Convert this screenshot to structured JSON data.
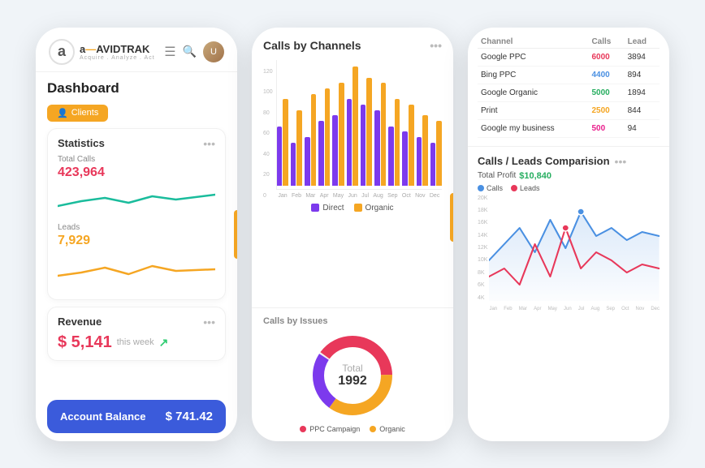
{
  "app": {
    "name": "AVIDTRAK",
    "tagline": "Acquire . Analyze . Act"
  },
  "left_phone": {
    "dashboard_title": "Dashboard",
    "clients_btn": "Clients",
    "statistics": {
      "title": "Statistics",
      "total_calls_label": "Total Calls",
      "total_calls_value": "423,964",
      "leads_label": "Leads",
      "leads_value": "7,929"
    },
    "revenue": {
      "title": "Revenue",
      "amount": "$ 5,141",
      "period": "this week"
    },
    "account_balance": {
      "label": "Account Balance",
      "amount": "$ 741.42"
    }
  },
  "middle_phone": {
    "chart_title": "Calls by Channels",
    "bar_data": {
      "months": [
        "Jan",
        "Feb",
        "Mar",
        "Apr",
        "May",
        "Jun",
        "Jul",
        "Aug",
        "Sep",
        "Oct",
        "Nov",
        "Dec"
      ],
      "direct": [
        55,
        40,
        45,
        60,
        65,
        80,
        75,
        70,
        55,
        50,
        45,
        40
      ],
      "organic": [
        80,
        70,
        85,
        90,
        95,
        110,
        100,
        95,
        80,
        75,
        65,
        60
      ]
    },
    "legend": {
      "direct": "Direct",
      "organic": "Organic"
    },
    "y_axis": [
      "120",
      "100",
      "80",
      "60",
      "40",
      "20",
      "0"
    ],
    "donut_section_title": "Calls by Issues",
    "donut": {
      "total_label": "Total",
      "total_value": "1992",
      "ppc_label": "PPC Campaign",
      "organic_label": "Organic",
      "ppc_color": "#e8385a",
      "organic_color": "#f5a623",
      "ring_color": "#7c3aed"
    }
  },
  "right_phone": {
    "table": {
      "headers": [
        "Channel",
        "Calls",
        "Lead"
      ],
      "rows": [
        {
          "channel": "Google PPC",
          "calls": "6000",
          "lead": "3894",
          "calls_class": "red"
        },
        {
          "channel": "Bing PPC",
          "calls": "4400",
          "lead": "894",
          "calls_class": "blue"
        },
        {
          "channel": "Google Organic",
          "calls": "5000",
          "lead": "1894",
          "calls_class": "green"
        },
        {
          "channel": "Print",
          "calls": "2500",
          "lead": "844",
          "calls_class": "orange"
        },
        {
          "channel": "Google my business",
          "calls": "500",
          "lead": "94",
          "calls_class": "pink"
        }
      ]
    },
    "line_chart": {
      "title": "Calls / Leads Comparision",
      "profit_label": "Total Profit",
      "profit_value": "$10,840",
      "calls_label": "Calls",
      "leads_label": "Leads",
      "calls_color": "#4a90e2",
      "leads_color": "#e8385a",
      "y_labels": [
        "20K",
        "18K",
        "16K",
        "14K",
        "12K",
        "10K",
        "8K",
        "6K",
        "4K"
      ],
      "x_labels": [
        "Jan",
        "Feb",
        "Mar",
        "Apr",
        "May",
        "Jun",
        "Jul",
        "Aug",
        "Sep",
        "Oct",
        "Nov",
        "Dec"
      ]
    }
  }
}
